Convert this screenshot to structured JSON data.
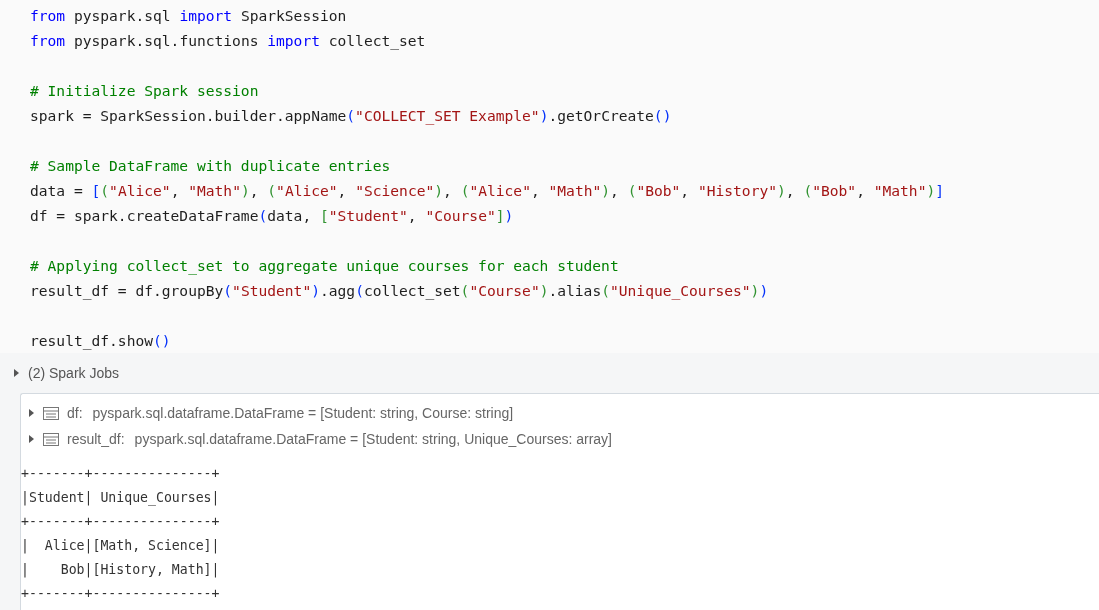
{
  "code": {
    "lines": [
      {
        "kind": "code",
        "tokens": [
          {
            "kind": "kw",
            "text": "from"
          },
          {
            "kind": "t",
            "text": " pyspark.sql "
          },
          {
            "kind": "kw",
            "text": "import"
          },
          {
            "kind": "t",
            "text": " SparkSession"
          }
        ]
      },
      {
        "kind": "code",
        "tokens": [
          {
            "kind": "kw",
            "text": "from"
          },
          {
            "kind": "t",
            "text": " pyspark.sql.functions "
          },
          {
            "kind": "kw",
            "text": "import"
          },
          {
            "kind": "t",
            "text": " collect_set"
          }
        ]
      },
      {
        "kind": "blank"
      },
      {
        "kind": "code",
        "tokens": [
          {
            "kind": "cm",
            "text": "# Initialize Spark session"
          }
        ]
      },
      {
        "kind": "code",
        "tokens": [
          {
            "kind": "t",
            "text": "spark = SparkSession.builder.appName"
          },
          {
            "kind": "b1",
            "text": "("
          },
          {
            "kind": "s",
            "text": "\"COLLECT_SET Example\""
          },
          {
            "kind": "b1",
            "text": ")"
          },
          {
            "kind": "t",
            "text": ".getOrCreate"
          },
          {
            "kind": "b1",
            "text": "()"
          }
        ]
      },
      {
        "kind": "blank"
      },
      {
        "kind": "code",
        "tokens": [
          {
            "kind": "cm",
            "text": "# Sample DataFrame with duplicate entries"
          }
        ]
      },
      {
        "kind": "code",
        "tokens": [
          {
            "kind": "t",
            "text": "data = "
          },
          {
            "kind": "b1",
            "text": "["
          },
          {
            "kind": "b2",
            "text": "("
          },
          {
            "kind": "s",
            "text": "\"Alice\""
          },
          {
            "kind": "t",
            "text": ", "
          },
          {
            "kind": "s",
            "text": "\"Math\""
          },
          {
            "kind": "b2",
            "text": ")"
          },
          {
            "kind": "t",
            "text": ", "
          },
          {
            "kind": "b2",
            "text": "("
          },
          {
            "kind": "s",
            "text": "\"Alice\""
          },
          {
            "kind": "t",
            "text": ", "
          },
          {
            "kind": "s",
            "text": "\"Science\""
          },
          {
            "kind": "b2",
            "text": ")"
          },
          {
            "kind": "t",
            "text": ", "
          },
          {
            "kind": "b2",
            "text": "("
          },
          {
            "kind": "s",
            "text": "\"Alice\""
          },
          {
            "kind": "t",
            "text": ", "
          },
          {
            "kind": "s",
            "text": "\"Math\""
          },
          {
            "kind": "b2",
            "text": ")"
          },
          {
            "kind": "t",
            "text": ", "
          },
          {
            "kind": "b2",
            "text": "("
          },
          {
            "kind": "s",
            "text": "\"Bob\""
          },
          {
            "kind": "t",
            "text": ", "
          },
          {
            "kind": "s",
            "text": "\"History\""
          },
          {
            "kind": "b2",
            "text": ")"
          },
          {
            "kind": "t",
            "text": ", "
          },
          {
            "kind": "b2",
            "text": "("
          },
          {
            "kind": "s",
            "text": "\"Bob\""
          },
          {
            "kind": "t",
            "text": ", "
          },
          {
            "kind": "s",
            "text": "\"Math\""
          },
          {
            "kind": "b2",
            "text": ")"
          },
          {
            "kind": "b1",
            "text": "]"
          }
        ]
      },
      {
        "kind": "code",
        "tokens": [
          {
            "kind": "t",
            "text": "df = spark.createDataFrame"
          },
          {
            "kind": "b1",
            "text": "("
          },
          {
            "kind": "t",
            "text": "data, "
          },
          {
            "kind": "b2",
            "text": "["
          },
          {
            "kind": "s",
            "text": "\"Student\""
          },
          {
            "kind": "t",
            "text": ", "
          },
          {
            "kind": "s",
            "text": "\"Course\""
          },
          {
            "kind": "b2",
            "text": "]"
          },
          {
            "kind": "b1",
            "text": ")"
          }
        ]
      },
      {
        "kind": "blank"
      },
      {
        "kind": "code",
        "tokens": [
          {
            "kind": "cm",
            "text": "# Applying collect_set to aggregate unique courses for each student"
          }
        ]
      },
      {
        "kind": "code",
        "tokens": [
          {
            "kind": "t",
            "text": "result_df = df.groupBy"
          },
          {
            "kind": "b1",
            "text": "("
          },
          {
            "kind": "s",
            "text": "\"Student\""
          },
          {
            "kind": "b1",
            "text": ")"
          },
          {
            "kind": "t",
            "text": ".agg"
          },
          {
            "kind": "b1",
            "text": "("
          },
          {
            "kind": "t",
            "text": "collect_set"
          },
          {
            "kind": "b2",
            "text": "("
          },
          {
            "kind": "s",
            "text": "\"Course\""
          },
          {
            "kind": "b2",
            "text": ")"
          },
          {
            "kind": "t",
            "text": ".alias"
          },
          {
            "kind": "b2",
            "text": "("
          },
          {
            "kind": "s",
            "text": "\"Unique_Courses\""
          },
          {
            "kind": "b2",
            "text": ")"
          },
          {
            "kind": "b1",
            "text": ")"
          }
        ]
      },
      {
        "kind": "blank"
      },
      {
        "kind": "code",
        "tokens": [
          {
            "kind": "t",
            "text": "result_df.show"
          },
          {
            "kind": "b1",
            "text": "()"
          }
        ]
      }
    ]
  },
  "spark_jobs": {
    "label": "(2) Spark Jobs",
    "expanded": false
  },
  "schemas": [
    {
      "name": "df:",
      "type": "pyspark.sql.dataframe.DataFrame = [Student: string, Course: string]",
      "expanded": false
    },
    {
      "name": "result_df:",
      "type": "pyspark.sql.dataframe.DataFrame = [Student: string, Unique_Courses: array]",
      "expanded": false
    }
  ],
  "output": [
    "+-------+---------------+",
    "|Student| Unique_Courses|",
    "+-------+---------------+",
    "|  Alice|[Math, Science]|",
    "|    Bob|[History, Math]|",
    "+-------+---------------+"
  ]
}
